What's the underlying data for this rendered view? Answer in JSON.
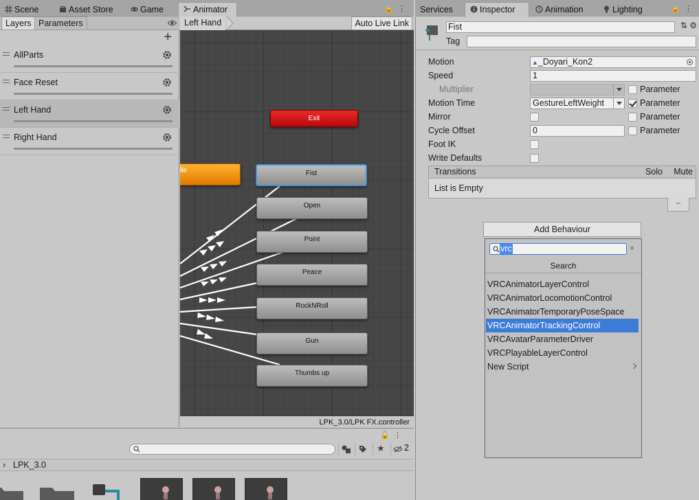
{
  "left_tabs": [
    {
      "label": "Scene",
      "icon": "grid-icon"
    },
    {
      "label": "Asset Store",
      "icon": "store-icon"
    },
    {
      "label": "Game",
      "icon": "gamepad-icon"
    },
    {
      "label": "Animator",
      "icon": "animator-icon",
      "active": true
    }
  ],
  "right_tabs": [
    {
      "label": "Services",
      "icon": ""
    },
    {
      "label": "Inspector",
      "icon": "info-icon",
      "active": true
    },
    {
      "label": "Animation",
      "icon": "animation-icon"
    },
    {
      "label": "Lighting",
      "icon": "bulb-icon"
    }
  ],
  "layers_panel": {
    "tab_layers": "Layers",
    "tab_parameters": "Parameters",
    "layers": [
      {
        "name": "AllParts",
        "selected": false
      },
      {
        "name": "Face Reset",
        "selected": false
      },
      {
        "name": "Left Hand",
        "selected": true
      },
      {
        "name": "Right Hand",
        "selected": false
      }
    ]
  },
  "graph": {
    "breadcrumb": "Left Hand",
    "auto_live_link": "Auto Live Link",
    "path": "LPK_3.0/LPK FX.controller",
    "exit_label": "Exit",
    "idle_label": "Idle",
    "states": [
      "Fist",
      "Open",
      "Point",
      "Peace",
      "RockNRoll",
      "Gun",
      "Thumbs up"
    ]
  },
  "project": {
    "folder": "LPK_3.0",
    "hidden_count": "2"
  },
  "inspector": {
    "state_name": "Fist",
    "tag_label": "Tag",
    "tag_value": "",
    "motion_label": "Motion",
    "motion_value": "_Doyari_Kon2",
    "speed_label": "Speed",
    "speed_value": "1",
    "multiplier_label": "Multiplier",
    "multiplier_value": "",
    "motion_time_label": "Motion Time",
    "motion_time_value": "GestureLeftWeight",
    "mirror_label": "Mirror",
    "cycle_offset_label": "Cycle Offset",
    "cycle_offset_value": "0",
    "foot_ik_label": "Foot IK",
    "write_defaults_label": "Write Defaults",
    "parameter_label": "Parameter",
    "transitions_label": "Transitions",
    "solo_label": "Solo",
    "mute_label": "Mute",
    "list_empty": "List is Empty",
    "minus": "−",
    "add_behaviour": "Add Behaviour"
  },
  "behaviour_popup": {
    "search_text": "vrc",
    "clear": "×",
    "title": "Search",
    "items": [
      {
        "label": "VRCAnimatorLayerControl",
        "highlighted": false
      },
      {
        "label": "VRCAnimatorLocomotionControl",
        "highlighted": false
      },
      {
        "label": "VRCAnimatorTemporaryPoseSpace",
        "highlighted": false
      },
      {
        "label": "VRCAnimatorTrackingControl",
        "highlighted": true
      },
      {
        "label": "VRCAvatarParameterDriver",
        "highlighted": false
      },
      {
        "label": "VRCPlayableLayerControl",
        "highlighted": false
      },
      {
        "label": "New Script",
        "highlighted": false,
        "submenu": true
      }
    ]
  },
  "colors": {
    "selection_blue": "#3d7bd8",
    "exit_red": "#d81b1b",
    "idle_orange": "#f59a16",
    "graph_bg": "#474747"
  }
}
